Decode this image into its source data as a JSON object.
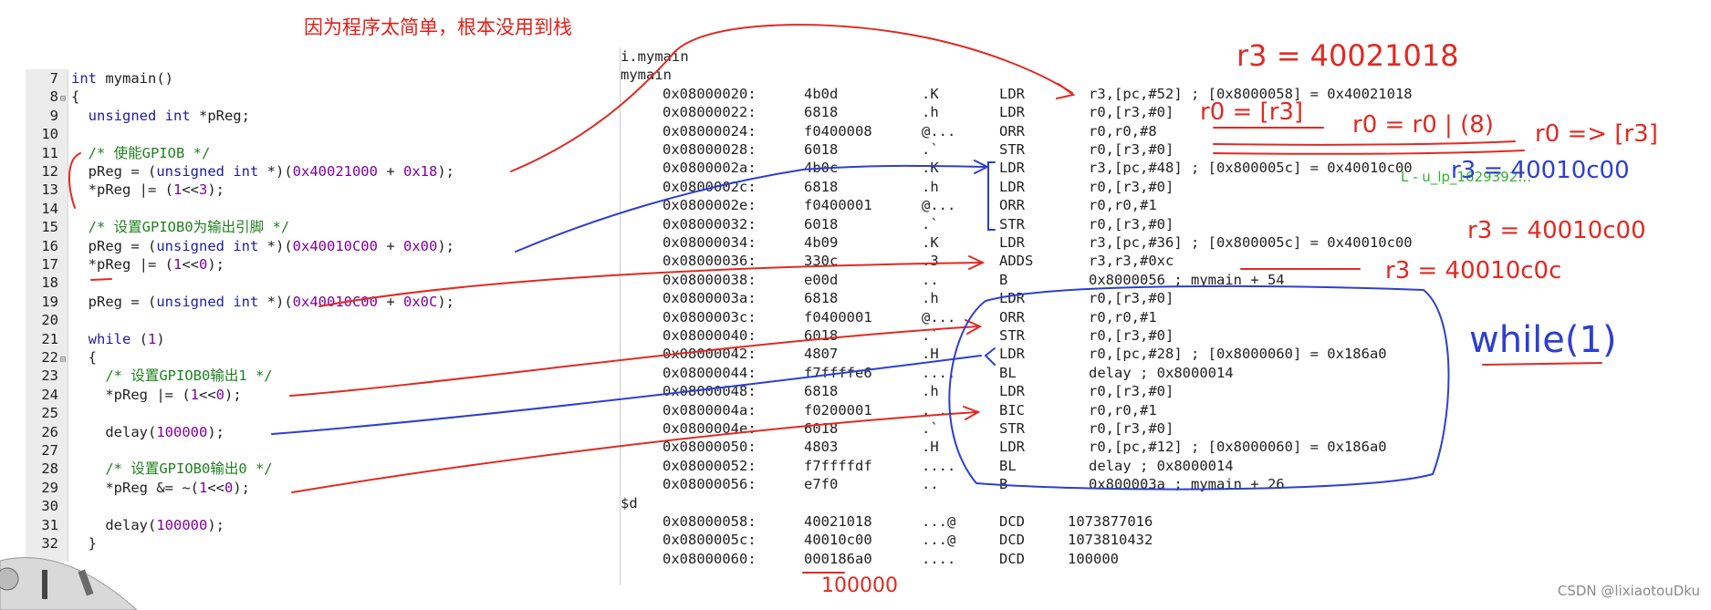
{
  "annotation_title": "因为程序太简单，根本没用到栈",
  "editor": {
    "lines": [
      {
        "num": "7",
        "fold": "",
        "segs": [
          [
            "kw",
            "int "
          ],
          [
            "tx",
            "mymain()"
          ]
        ]
      },
      {
        "num": "8",
        "fold": "⊟",
        "segs": [
          [
            "tx",
            "{"
          ]
        ]
      },
      {
        "num": "9",
        "fold": "",
        "segs": [
          [
            "kw",
            "  unsigned int "
          ],
          [
            "tx",
            "*pReg;"
          ]
        ]
      },
      {
        "num": "10",
        "fold": "",
        "segs": []
      },
      {
        "num": "11",
        "fold": "",
        "segs": [
          [
            "cm",
            "  /* 使能GPIOB */"
          ]
        ]
      },
      {
        "num": "12",
        "fold": "",
        "segs": [
          [
            "tx",
            "  pReg = ("
          ],
          [
            "kw",
            "unsigned int "
          ],
          [
            "tx",
            "*)("
          ],
          [
            "nm",
            "0x40021000"
          ],
          [
            "tx",
            " + "
          ],
          [
            "nm",
            "0x18"
          ],
          [
            "tx",
            ");"
          ]
        ]
      },
      {
        "num": "13",
        "fold": "",
        "segs": [
          [
            "tx",
            "  *pReg |= ("
          ],
          [
            "nm",
            "1"
          ],
          [
            "tx",
            "<<"
          ],
          [
            "nm",
            "3"
          ],
          [
            "tx",
            ");"
          ]
        ]
      },
      {
        "num": "14",
        "fold": "",
        "segs": []
      },
      {
        "num": "15",
        "fold": "",
        "segs": [
          [
            "cm",
            "  /* 设置GPIOB0为输出引脚 */"
          ]
        ]
      },
      {
        "num": "16",
        "fold": "",
        "segs": [
          [
            "tx",
            "  pReg = ("
          ],
          [
            "kw",
            "unsigned int "
          ],
          [
            "tx",
            "*)("
          ],
          [
            "nm",
            "0x40010C00"
          ],
          [
            "tx",
            " + "
          ],
          [
            "nm",
            "0x00"
          ],
          [
            "tx",
            ");"
          ]
        ]
      },
      {
        "num": "17",
        "fold": "",
        "segs": [
          [
            "tx",
            "  *pReg |= ("
          ],
          [
            "nm",
            "1"
          ],
          [
            "tx",
            "<<"
          ],
          [
            "nm",
            "0"
          ],
          [
            "tx",
            ");"
          ]
        ]
      },
      {
        "num": "18",
        "fold": "",
        "segs": []
      },
      {
        "num": "19",
        "fold": "",
        "segs": [
          [
            "tx",
            "  pReg = ("
          ],
          [
            "kw",
            "unsigned int "
          ],
          [
            "tx",
            "*)("
          ],
          [
            "nm",
            "0x40010C00"
          ],
          [
            "tx",
            " + "
          ],
          [
            "nm",
            "0x0C"
          ],
          [
            "tx",
            ");"
          ]
        ]
      },
      {
        "num": "20",
        "fold": "",
        "segs": []
      },
      {
        "num": "21",
        "fold": "",
        "segs": [
          [
            "kw",
            "  while "
          ],
          [
            "tx",
            "("
          ],
          [
            "nm",
            "1"
          ],
          [
            "tx",
            ")"
          ]
        ]
      },
      {
        "num": "22",
        "fold": "⊟",
        "segs": [
          [
            "tx",
            "  {"
          ]
        ]
      },
      {
        "num": "23",
        "fold": "",
        "segs": [
          [
            "cm",
            "    /* 设置GPIOB0输出1 */"
          ]
        ]
      },
      {
        "num": "24",
        "fold": "",
        "segs": [
          [
            "tx",
            "    *pReg |= ("
          ],
          [
            "nm",
            "1"
          ],
          [
            "tx",
            "<<"
          ],
          [
            "nm",
            "0"
          ],
          [
            "tx",
            ");"
          ]
        ]
      },
      {
        "num": "25",
        "fold": "",
        "segs": []
      },
      {
        "num": "26",
        "fold": "",
        "segs": [
          [
            "tx",
            "    delay("
          ],
          [
            "nm",
            "100000"
          ],
          [
            "tx",
            ");"
          ]
        ]
      },
      {
        "num": "27",
        "fold": "",
        "segs": []
      },
      {
        "num": "28",
        "fold": "",
        "segs": [
          [
            "cm",
            "    /* 设置GPIOB0输出0 */"
          ]
        ]
      },
      {
        "num": "29",
        "fold": "",
        "segs": [
          [
            "tx",
            "    *pReg &= ~("
          ],
          [
            "nm",
            "1"
          ],
          [
            "tx",
            "<<"
          ],
          [
            "nm",
            "0"
          ],
          [
            "tx",
            ");"
          ]
        ]
      },
      {
        "num": "30",
        "fold": "",
        "segs": []
      },
      {
        "num": "31",
        "fold": "",
        "segs": [
          [
            "tx",
            "    delay("
          ],
          [
            "nm",
            "100000"
          ],
          [
            "tx",
            ");"
          ]
        ]
      },
      {
        "num": "32",
        "fold": "",
        "segs": [
          [
            "tx",
            "  }"
          ]
        ]
      }
    ]
  },
  "disasm": {
    "rows": [
      {
        "label": "i.mymain"
      },
      {
        "label": "mymain"
      },
      {
        "addr": "0x08000020:",
        "hex": "4b0d",
        "ascii": ".K",
        "op": "LDR",
        "args": "r3,[pc,#52] ; [0x8000058] = 0x40021018"
      },
      {
        "addr": "0x08000022:",
        "hex": "6818",
        "ascii": ".h",
        "op": "LDR",
        "args": "r0,[r3,#0]"
      },
      {
        "addr": "0x08000024:",
        "hex": "f0400008",
        "ascii": "@...",
        "op": "ORR",
        "args": "r0,r0,#8"
      },
      {
        "addr": "0x08000028:",
        "hex": "6018",
        "ascii": ".`",
        "op": "STR",
        "args": "r0,[r3,#0]"
      },
      {
        "addr": "0x0800002a:",
        "hex": "4b0c",
        "ascii": ".K",
        "op": "LDR",
        "args": "r3,[pc,#48] ; [0x800005c] = 0x40010c00"
      },
      {
        "addr": "0x0800002c:",
        "hex": "6818",
        "ascii": ".h",
        "op": "LDR",
        "args": "r0,[r3,#0]"
      },
      {
        "addr": "0x0800002e:",
        "hex": "f0400001",
        "ascii": "@...",
        "op": "ORR",
        "args": "r0,r0,#1"
      },
      {
        "addr": "0x08000032:",
        "hex": "6018",
        "ascii": ".`",
        "op": "STR",
        "args": "r0,[r3,#0]"
      },
      {
        "addr": "0x08000034:",
        "hex": "4b09",
        "ascii": ".K",
        "op": "LDR",
        "args": "r3,[pc,#36] ; [0x800005c] = 0x40010c00"
      },
      {
        "addr": "0x08000036:",
        "hex": "330c",
        "ascii": ".3",
        "op": "ADDS",
        "args": "r3,r3,#0xc"
      },
      {
        "addr": "0x08000038:",
        "hex": "e00d",
        "ascii": "..",
        "op": "B",
        "args": "0x8000056 ; mymain + 54"
      },
      {
        "addr": "0x0800003a:",
        "hex": "6818",
        "ascii": ".h",
        "op": "LDR",
        "args": "r0,[r3,#0]"
      },
      {
        "addr": "0x0800003c:",
        "hex": "f0400001",
        "ascii": "@...",
        "op": "ORR",
        "args": "r0,r0,#1"
      },
      {
        "addr": "0x08000040:",
        "hex": "6018",
        "ascii": ".`",
        "op": "STR",
        "args": "r0,[r3,#0]"
      },
      {
        "addr": "0x08000042:",
        "hex": "4807",
        "ascii": ".H",
        "op": "LDR",
        "args": "r0,[pc,#28] ; [0x8000060] = 0x186a0"
      },
      {
        "addr": "0x08000044:",
        "hex": "f7ffffe6",
        "ascii": "....",
        "op": "BL",
        "args": "delay ; 0x8000014"
      },
      {
        "addr": "0x08000048:",
        "hex": "6818",
        "ascii": ".h",
        "op": "LDR",
        "args": "r0,[r3,#0]"
      },
      {
        "addr": "0x0800004a:",
        "hex": "f0200001",
        "ascii": ". ..",
        "op": "BIC",
        "args": "r0,r0,#1"
      },
      {
        "addr": "0x0800004e:",
        "hex": "6018",
        "ascii": ".`",
        "op": "STR",
        "args": "r0,[r3,#0]"
      },
      {
        "addr": "0x08000050:",
        "hex": "4803",
        "ascii": ".H",
        "op": "LDR",
        "args": "r0,[pc,#12] ; [0x8000060] = 0x186a0"
      },
      {
        "addr": "0x08000052:",
        "hex": "f7ffffdf",
        "ascii": "....",
        "op": "BL",
        "args": "delay ; 0x8000014"
      },
      {
        "addr": "0x08000056:",
        "hex": "e7f0",
        "ascii": "..",
        "op": "B",
        "args": "0x800003a ; mymain + 26"
      },
      {
        "label": "$d"
      },
      {
        "addr": "0x08000058:",
        "hex": "40021018",
        "ascii": "...@",
        "op": "DCD",
        "args": "1073877016",
        "wide": true
      },
      {
        "addr": "0x0800005c:",
        "hex": "40010c00",
        "ascii": "...@",
        "op": "DCD",
        "args": "1073810432",
        "wide": true
      },
      {
        "addr": "0x08000060:",
        "hex": "000186a0",
        "ascii": "....",
        "op": "DCD",
        "args": "100000",
        "wide": true
      }
    ]
  },
  "side_text": "L - u_lp_1629392…",
  "handwritten": {
    "r3_value": "r3 = 40021018",
    "r0_load": "r0 = [r3]",
    "r0_or": "r0 = r0 | (8)",
    "r0_store": "r0 => [r3]",
    "r3_right": "r3 = 40010c00",
    "r3_mid": "r3 = 40010c00",
    "r3_add": "r3 = 40010c0c",
    "while_loop": "while(1)",
    "hundred_k": "100000"
  },
  "watermark": "CSDN @lixiaotouDku"
}
